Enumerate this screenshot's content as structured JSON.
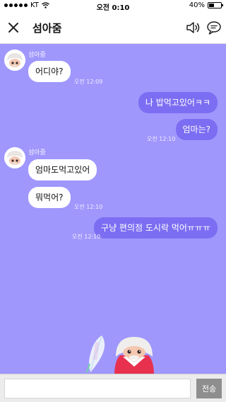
{
  "status_bar": {
    "carrier": "KT",
    "time": "오전 0:10",
    "battery_percent": "40%",
    "battery_level": 0.4
  },
  "header": {
    "title": "섬아줌",
    "icons": [
      "close-icon",
      "speaker-icon",
      "chat-bubble-icon"
    ]
  },
  "messages": [
    {
      "direction": "in",
      "sender": "섬아줌",
      "text": "어디야?",
      "time": "오전 12:09"
    },
    {
      "direction": "out",
      "text": "나 밥먹고있어ㅋㅋ"
    },
    {
      "direction": "out",
      "text": "엄마는?",
      "time": "오전 12:10"
    },
    {
      "direction": "in",
      "sender": "섬아줌",
      "text": "엄마도먹고있어"
    },
    {
      "direction": "in",
      "text": "뭐먹어?",
      "time": "오전 12:10"
    },
    {
      "direction": "out",
      "text": "구냥 편의점 도시락 먹어ㅠㅠㅠ",
      "time": "오전 12:10"
    }
  ],
  "composer": {
    "input_value": "",
    "send_label": "전송"
  },
  "colors": {
    "chat_background": "#9f97fc",
    "outgoing_bubble": "#7c6ef2",
    "incoming_bubble": "#ffffff",
    "send_button": "#8e8e8e"
  }
}
